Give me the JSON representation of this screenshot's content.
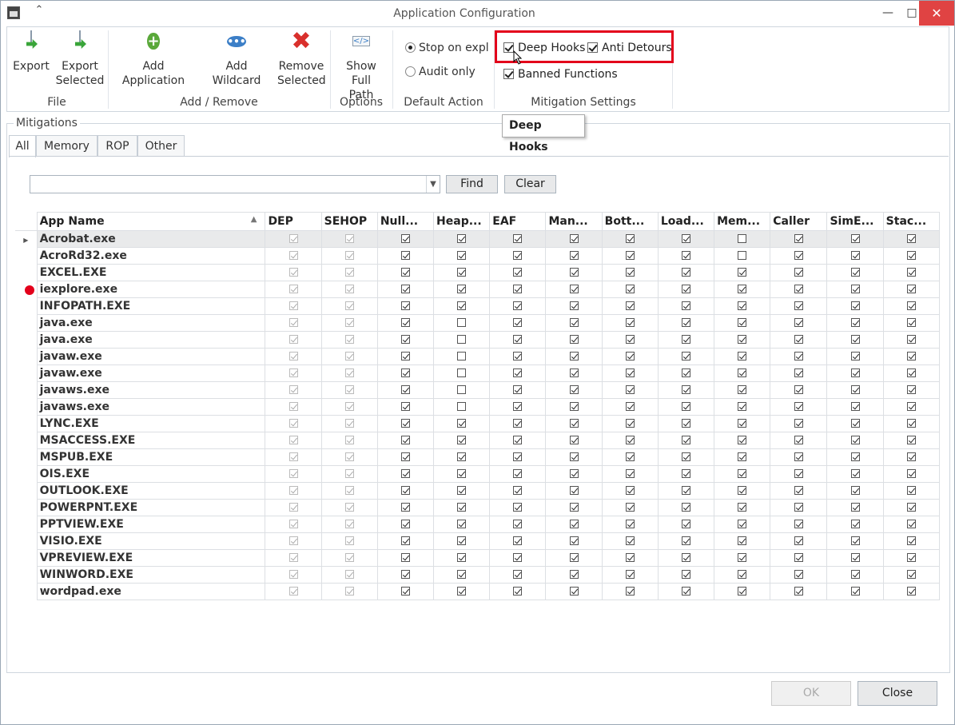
{
  "window": {
    "title": "Application Configuration",
    "minimize": "—",
    "maximize": "□",
    "close": "✕"
  },
  "ribbon": {
    "export": "Export",
    "export_selected": [
      "Export",
      "Selected"
    ],
    "add_application": "Add Application",
    "add_wildcard": "Add Wildcard",
    "remove_selected": [
      "Remove",
      "Selected"
    ],
    "show_full_path": [
      "Show Full",
      "Path"
    ],
    "group_file": "File",
    "group_add_remove": "Add / Remove",
    "group_options": "Options",
    "group_default_action": "Default Action",
    "group_mitigation_settings": "Mitigation Settings",
    "stop_on_exploit": "Stop on expl",
    "audit_only": "Audit only",
    "deep_hooks": "Deep Hooks",
    "anti_detours": "Anti Detours",
    "banned_functions": "Banned Functions"
  },
  "tooltip": "Deep Hooks",
  "mitigations": {
    "label": "Mitigations",
    "tabs": [
      "All",
      "Memory",
      "ROP",
      "Other"
    ],
    "find": "Find",
    "clear": "Clear",
    "search_value": ""
  },
  "grid": {
    "columns": [
      "App Name",
      "DEP",
      "SEHOP",
      "Null...",
      "Heap...",
      "EAF",
      "Man...",
      "Bott...",
      "Load...",
      "Mem...",
      "Caller",
      "SimE...",
      "Stac..."
    ],
    "rows": [
      {
        "name": "Acrobat.exe",
        "heap": true,
        "mem": false
      },
      {
        "name": "AcroRd32.exe",
        "heap": true,
        "mem": false
      },
      {
        "name": "EXCEL.EXE",
        "heap": true,
        "mem": true
      },
      {
        "name": "iexplore.exe",
        "heap": true,
        "mem": true
      },
      {
        "name": "INFOPATH.EXE",
        "heap": true,
        "mem": true
      },
      {
        "name": "java.exe",
        "heap": false,
        "mem": true
      },
      {
        "name": "java.exe",
        "heap": false,
        "mem": true
      },
      {
        "name": "javaw.exe",
        "heap": false,
        "mem": true
      },
      {
        "name": "javaw.exe",
        "heap": false,
        "mem": true
      },
      {
        "name": "javaws.exe",
        "heap": false,
        "mem": true
      },
      {
        "name": "javaws.exe",
        "heap": false,
        "mem": true
      },
      {
        "name": "LYNC.EXE",
        "heap": true,
        "mem": true
      },
      {
        "name": "MSACCESS.EXE",
        "heap": true,
        "mem": true
      },
      {
        "name": "MSPUB.EXE",
        "heap": true,
        "mem": true
      },
      {
        "name": "OIS.EXE",
        "heap": true,
        "mem": true
      },
      {
        "name": "OUTLOOK.EXE",
        "heap": true,
        "mem": true
      },
      {
        "name": "POWERPNT.EXE",
        "heap": true,
        "mem": true
      },
      {
        "name": "PPTVIEW.EXE",
        "heap": true,
        "mem": true
      },
      {
        "name": "VISIO.EXE",
        "heap": true,
        "mem": true
      },
      {
        "name": "VPREVIEW.EXE",
        "heap": true,
        "mem": true
      },
      {
        "name": "WINWORD.EXE",
        "heap": true,
        "mem": true
      },
      {
        "name": "wordpad.exe",
        "heap": true,
        "mem": true
      }
    ]
  },
  "footer": {
    "ok": "OK",
    "close": "Close"
  }
}
